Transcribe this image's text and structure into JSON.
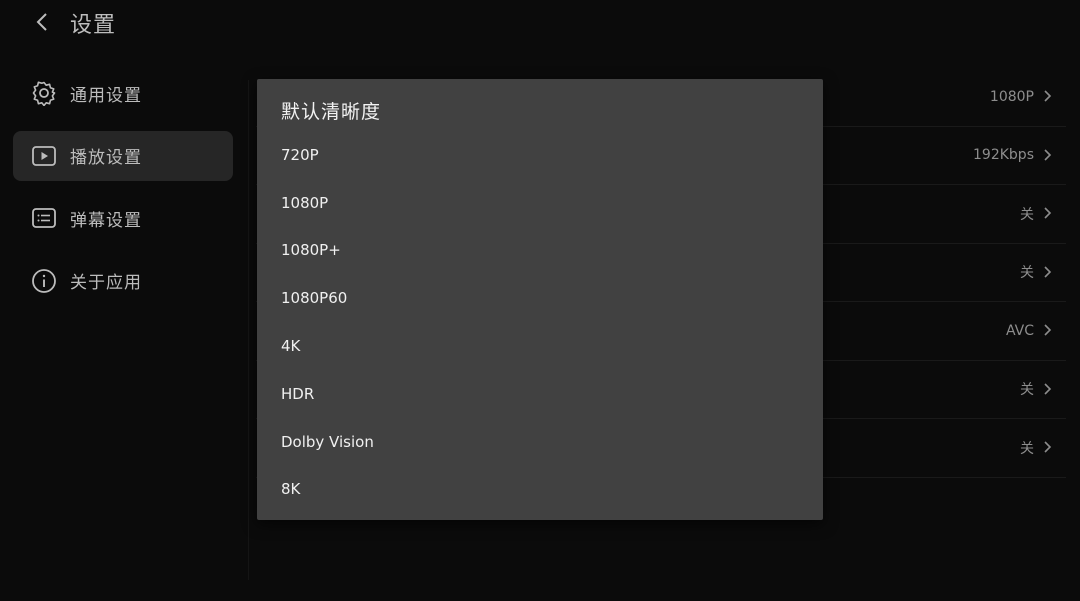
{
  "header": {
    "title": "设置"
  },
  "sidebar": {
    "items": [
      {
        "label": "通用设置",
        "icon": "gear-icon",
        "active": false
      },
      {
        "label": "播放设置",
        "icon": "play-icon",
        "active": true
      },
      {
        "label": "弹幕设置",
        "icon": "danmaku-icon",
        "active": false
      },
      {
        "label": "关于应用",
        "icon": "info-icon",
        "active": false
      }
    ]
  },
  "settings": {
    "rows": [
      {
        "value": "1080P"
      },
      {
        "value": "192Kbps"
      },
      {
        "value": "关"
      },
      {
        "value": "关"
      },
      {
        "value": "AVC"
      },
      {
        "value": "关"
      },
      {
        "value": "关"
      }
    ]
  },
  "dialog": {
    "title": "默认清晰度",
    "options": [
      "720P",
      "1080P",
      "1080P+",
      "1080P60",
      "4K",
      "HDR",
      "Dolby Vision",
      "8K"
    ]
  },
  "colors": {
    "background": "#0b0b0b",
    "sidebar_active": "#262626",
    "dialog_bg": "#414141",
    "text_primary": "#f0f0f0",
    "text_muted": "#8d8d8d"
  }
}
